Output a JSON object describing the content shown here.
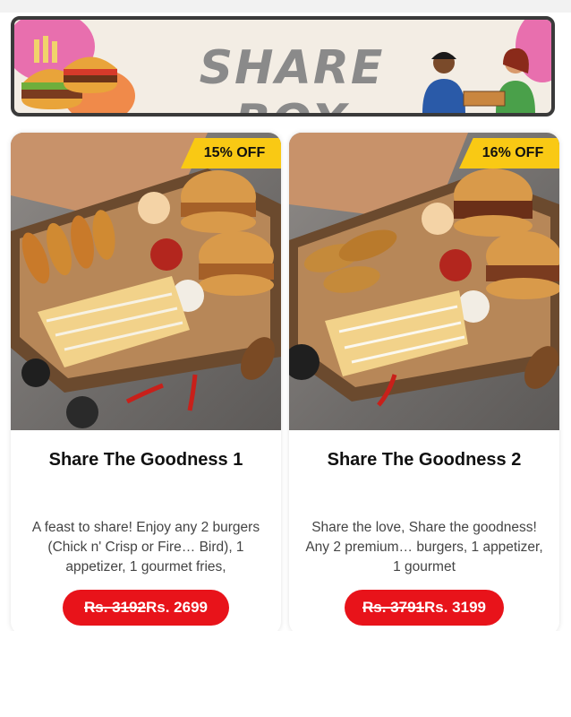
{
  "banner": {
    "title": "SHARE BOX",
    "icons": [
      "burger-illustration-icon",
      "people-sharing-box-illustration-icon"
    ]
  },
  "cards": [
    {
      "discount": "15% OFF",
      "title": "Share The Goodness 1",
      "description": "A feast to share! Enjoy any 2 burgers (Chick n' Crisp or Fire… Bird), 1 appetizer, 1 gourmet fries,",
      "price_old": "Rs. 3192",
      "price_new": "Rs. 2699"
    },
    {
      "discount": "16% OFF",
      "title": "Share The Goodness 2",
      "description": "Share the love, Share the goodness! Any 2 premium… burgers, 1 appetizer, 1 gourmet",
      "price_old": "Rs. 3791",
      "price_new": "Rs. 3199"
    }
  ],
  "colors": {
    "badge": "#f9c914",
    "price_pill": "#e8131a",
    "banner_bg": "#f3ede4",
    "banner_border": "#3a3a3a"
  }
}
